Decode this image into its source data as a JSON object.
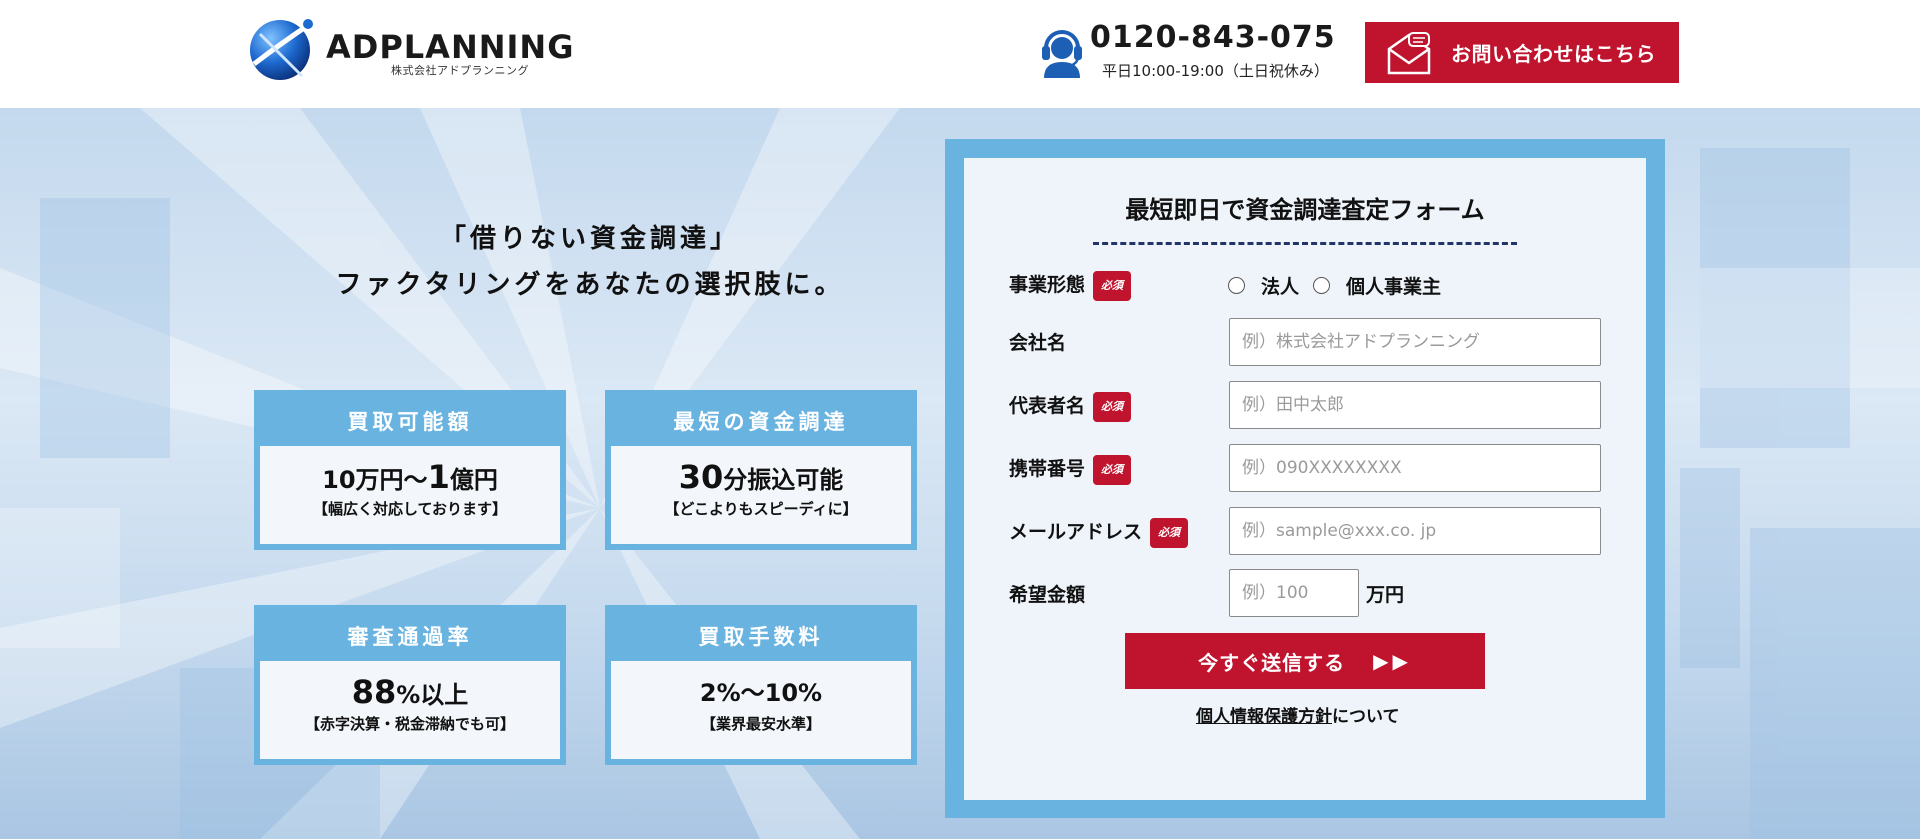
{
  "header": {
    "logo_text": "ADPLANNING",
    "logo_sub": "株式会社アドプランニング",
    "phone_number": "0120-843-075",
    "phone_hours": "平日10:00-19:00（土日祝休み）",
    "contact_label": "お問い合わせはこちら",
    "phone_icon": "operator-headset-icon",
    "contact_icon": "mail-envelope-icon"
  },
  "hero": {
    "tagline_line1": "「借りない資金調達」",
    "tagline_line2": "ファクタリングをあなたの選択肢に。",
    "stats": [
      {
        "title": "買取可能額",
        "value_a": "10万円〜",
        "value_big": "1",
        "value_b": "億円",
        "note": "【幅広く対応しております】"
      },
      {
        "title": "最短の資金調達",
        "value_big": "30",
        "value_b": "分振込可能",
        "note": "【どこよりもスピーディに】"
      },
      {
        "title": "審査通過率",
        "value_big": "88",
        "value_b": "%以上",
        "note": "【赤字決算・税金滞納でも可】"
      },
      {
        "title": "買取手数料",
        "value_b": "2%〜10%",
        "note": "【業界最安水準】"
      }
    ]
  },
  "form": {
    "title": "最短即日で資金調達査定フォーム",
    "required_badge": "必須",
    "business_type_label": "事業形態",
    "business_type_options": [
      "法人",
      "個人事業主"
    ],
    "company_label": "会社名",
    "company_placeholder": "例）株式会社アドプランニング",
    "rep_label": "代表者名",
    "rep_placeholder": "例）田中太郎",
    "mobile_label": "携帯番号",
    "mobile_placeholder": "例）090XXXXXXXX",
    "email_label": "メールアドレス",
    "email_placeholder": "例）sample@xxx.co. jp",
    "amount_label": "希望金額",
    "amount_placeholder": "例）100",
    "amount_unit": "万円",
    "submit_label": "今すぐ送信する",
    "submit_arrows": "▶▶",
    "privacy_link": "個人情報保護方針",
    "privacy_suffix": "について"
  },
  "colors": {
    "brand_red": "#c0132e",
    "frame_blue": "#69b3e1",
    "logo_blue": "#1d5fb5"
  }
}
